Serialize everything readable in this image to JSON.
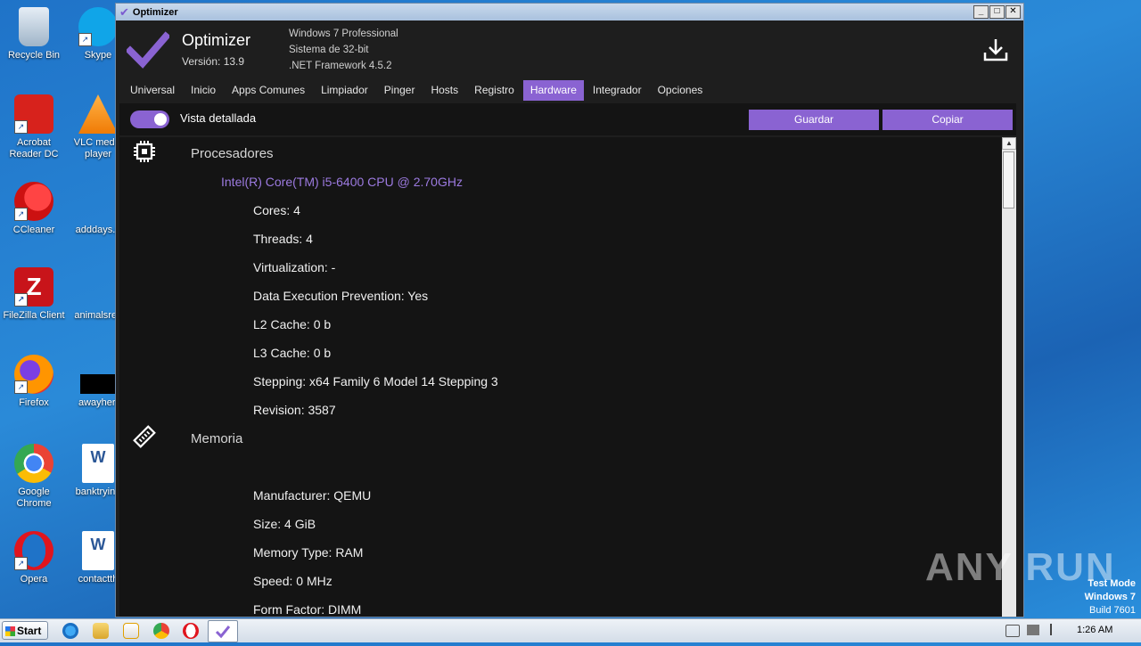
{
  "desktop": {
    "icons": [
      {
        "label": "Recycle Bin"
      },
      {
        "label": "Skype"
      },
      {
        "label": "Acrobat Reader DC"
      },
      {
        "label": "VLC media player"
      },
      {
        "label": "CCleaner"
      },
      {
        "label": "adddays.p"
      },
      {
        "label": "FileZilla Client"
      },
      {
        "label": "animalsrec"
      },
      {
        "label": "Firefox"
      },
      {
        "label": "awayher."
      },
      {
        "label": "Google Chrome"
      },
      {
        "label": "banktrying"
      },
      {
        "label": "Opera"
      },
      {
        "label": "contactth"
      }
    ]
  },
  "window": {
    "title": "Optimizer",
    "app_name": "Optimizer",
    "version": "Versión: 13.9",
    "sysinfo": [
      "Windows 7 Professional",
      "Sistema de 32-bit",
      ".NET Framework 4.5.2"
    ],
    "tabs": [
      "Universal",
      "Inicio",
      "Apps Comunes",
      "Limpiador",
      "Pinger",
      "Hosts",
      "Registro",
      "Hardware",
      "Integrador",
      "Opciones"
    ],
    "active_tab": "Hardware",
    "toolbar": {
      "toggle_label": "Vista detallada",
      "save_label": "Guardar",
      "copy_label": "Copiar"
    },
    "sections": {
      "processors": {
        "title": "Procesadores",
        "cpu_name": "Intel(R) Core(TM) i5-6400 CPU @ 2.70GHz",
        "props": [
          "Cores: 4",
          "Threads: 4",
          "Virtualization: -",
          "Data Execution Prevention: Yes",
          "L2 Cache: 0 b",
          "L3 Cache: 0 b",
          "Stepping: x64 Family 6 Model 14 Stepping 3",
          "Revision: 3587"
        ]
      },
      "memory": {
        "title": "Memoria",
        "props": [
          "Manufacturer: QEMU",
          "Size: 4 GiB",
          "Memory Type: RAM",
          "Speed: 0 MHz",
          "Form Factor: DIMM"
        ]
      }
    }
  },
  "taskbar": {
    "start_label": "Start",
    "clock": "1:26 AM"
  },
  "overlay": {
    "watermark": "ANY RUN",
    "testmode": [
      "Test Mode",
      "Windows 7",
      "Build 7601"
    ]
  },
  "colors": {
    "accent": "#8a63d2",
    "bg": "#141414"
  }
}
